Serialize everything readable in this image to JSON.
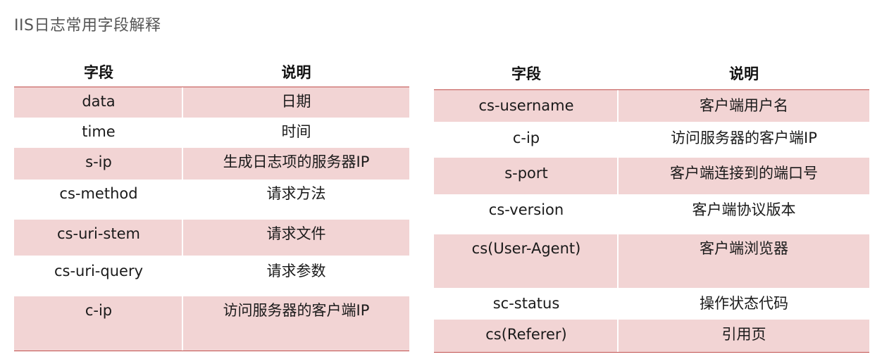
{
  "title": "IIS日志常用字段解释",
  "headers": {
    "field": "字段",
    "desc": "说明"
  },
  "left_rows": [
    {
      "field": "data",
      "desc": "日期"
    },
    {
      "field": "time",
      "desc": "时间"
    },
    {
      "field": "s-ip",
      "desc": "生成日志项的服务器IP"
    },
    {
      "field": "cs-method",
      "desc": "请求方法"
    },
    {
      "field": "cs-uri-stem",
      "desc": "请求文件"
    },
    {
      "field": "cs-uri-query",
      "desc": "请求参数"
    },
    {
      "field": "c-ip",
      "desc": "访问服务器的客户端IP"
    }
  ],
  "right_rows": [
    {
      "field": "cs-username",
      "desc": "客户端用户名"
    },
    {
      "field": "c-ip",
      "desc": "访问服务器的客户端IP"
    },
    {
      "field": "s-port",
      "desc": "客户端连接到的端口号"
    },
    {
      "field": "cs-version",
      "desc": "客户端协议版本"
    },
    {
      "field": "cs(User-Agent)",
      "desc": "客户端浏览器"
    },
    {
      "field": "sc-status",
      "desc": "操作状态代码"
    },
    {
      "field": "cs(Referer)",
      "desc": "引用页"
    }
  ],
  "colors": {
    "shade": "#f2d4d4",
    "rule": "#c0504d"
  }
}
